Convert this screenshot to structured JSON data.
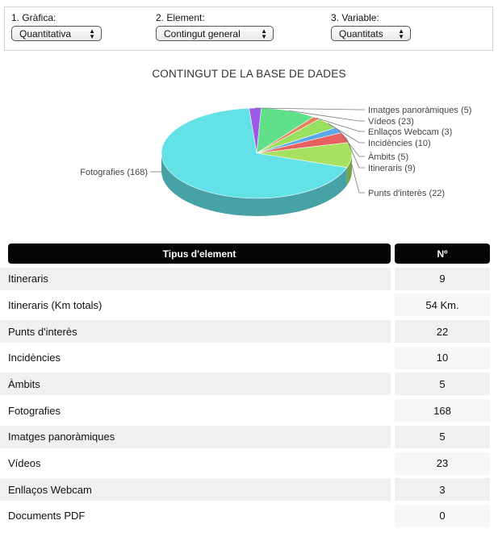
{
  "controls": {
    "chart": {
      "label": "1. Gràfica:",
      "value": "Quantitativa"
    },
    "element": {
      "label": "2. Element:",
      "value": "Contingut general"
    },
    "variable": {
      "label": "3. Variable:",
      "value": "Quantitats"
    }
  },
  "chart_data": {
    "type": "pie",
    "title": "CONTINGUT DE LA BASE DE DADES",
    "slices": [
      {
        "label": "Fotografies (168)",
        "name": "Fotografies",
        "value": 168,
        "color": "#62e1e7"
      },
      {
        "label": "Imatges panoràmiques (5)",
        "name": "Imatges panoràmiques",
        "value": 5,
        "color": "#9b59e8"
      },
      {
        "label": "Vídeos (23)",
        "name": "Vídeos",
        "value": 23,
        "color": "#60e089"
      },
      {
        "label": "Enllaços Webcam (3)",
        "name": "Enllaços Webcam",
        "value": 3,
        "color": "#e8805a"
      },
      {
        "label": "Incidències (10)",
        "name": "Incidències",
        "value": 10,
        "color": "#98e060"
      },
      {
        "label": "Àmbits (5)",
        "name": "Àmbits",
        "value": 5,
        "color": "#5aa8e8"
      },
      {
        "label": "Itineraris (9)",
        "name": "Itineraris",
        "value": 9,
        "color": "#e86060"
      },
      {
        "label": "Punts d'interès (22)",
        "name": "Punts d'interès",
        "value": 22,
        "color": "#a8e060"
      }
    ]
  },
  "table": {
    "headers": [
      "Tipus d'element",
      "Nº"
    ],
    "rows": [
      [
        "Itineraris",
        "9"
      ],
      [
        "Itineraris (Km totals)",
        "54 Km."
      ],
      [
        "Punts d'interès",
        "22"
      ],
      [
        "Incidències",
        "10"
      ],
      [
        "Àmbits",
        "5"
      ],
      [
        "Fotografies",
        "168"
      ],
      [
        "Imatges panoràmiques",
        "5"
      ],
      [
        "Vídeos",
        "23"
      ],
      [
        "Enllaços Webcam",
        "3"
      ],
      [
        "Documents PDF",
        "0"
      ]
    ]
  }
}
